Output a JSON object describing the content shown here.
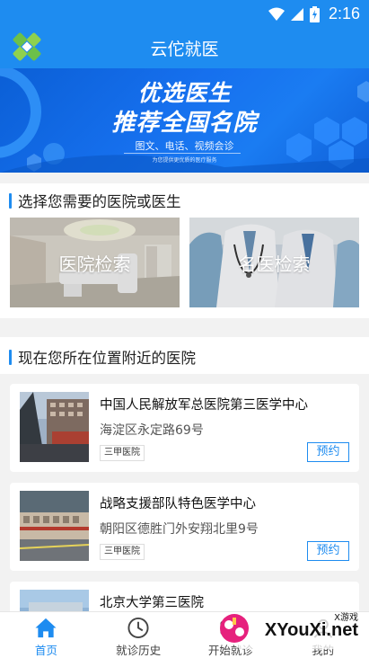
{
  "status_bar": {
    "time": "2:16",
    "icons": [
      "wifi-icon",
      "signal-icon",
      "battery-icon"
    ]
  },
  "app": {
    "title": "云佗就医"
  },
  "banner": {
    "headline1": "优选医生",
    "headline2": "推荐全国名院",
    "sub1": "图文、电话、视频会诊",
    "sub2": "为您提供更优质的医疗服务"
  },
  "select_section": {
    "title": "选择您需要的医院或医生",
    "tiles": [
      {
        "label": "医院检索"
      },
      {
        "label": "名医检索"
      }
    ]
  },
  "nearby_section": {
    "title": "现在您所在位置附近的医院",
    "hospitals": [
      {
        "name": "中国人民解放军总医院第三医学中心",
        "address": "海淀区永定路69号",
        "grade": "三甲医院",
        "book_label": "预约"
      },
      {
        "name": "战略支援部队特色医学中心",
        "address": "朝阳区德胜门外安翔北里9号",
        "grade": "三甲医院",
        "book_label": "预约"
      },
      {
        "name": "北京大学第三医院"
      }
    ]
  },
  "tab_bar": {
    "tabs": [
      {
        "label": "首页",
        "icon": "home-icon",
        "active": true
      },
      {
        "label": "就诊历史",
        "icon": "clock-icon",
        "active": false
      },
      {
        "label": "开始就诊",
        "icon": "video-icon",
        "active": false
      },
      {
        "label": "我的",
        "icon": "user-icon",
        "active": false
      }
    ]
  },
  "watermark": {
    "small": "X游戏",
    "big": "XYouXi.net"
  },
  "colors": {
    "primary": "#1e8cf0",
    "background": "#f2f2f2"
  }
}
